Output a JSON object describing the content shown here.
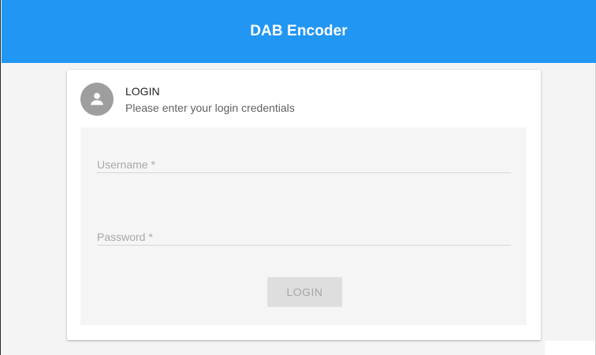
{
  "header": {
    "title": "DAB Encoder",
    "color": "#2196f3"
  },
  "login_card": {
    "title": "LOGIN",
    "subtitle": "Please enter your login credentials",
    "avatar_icon": "account-icon",
    "username": {
      "placeholder": "Username *",
      "value": ""
    },
    "password": {
      "placeholder": "Password *",
      "value": ""
    },
    "submit_label": "LOGIN"
  }
}
